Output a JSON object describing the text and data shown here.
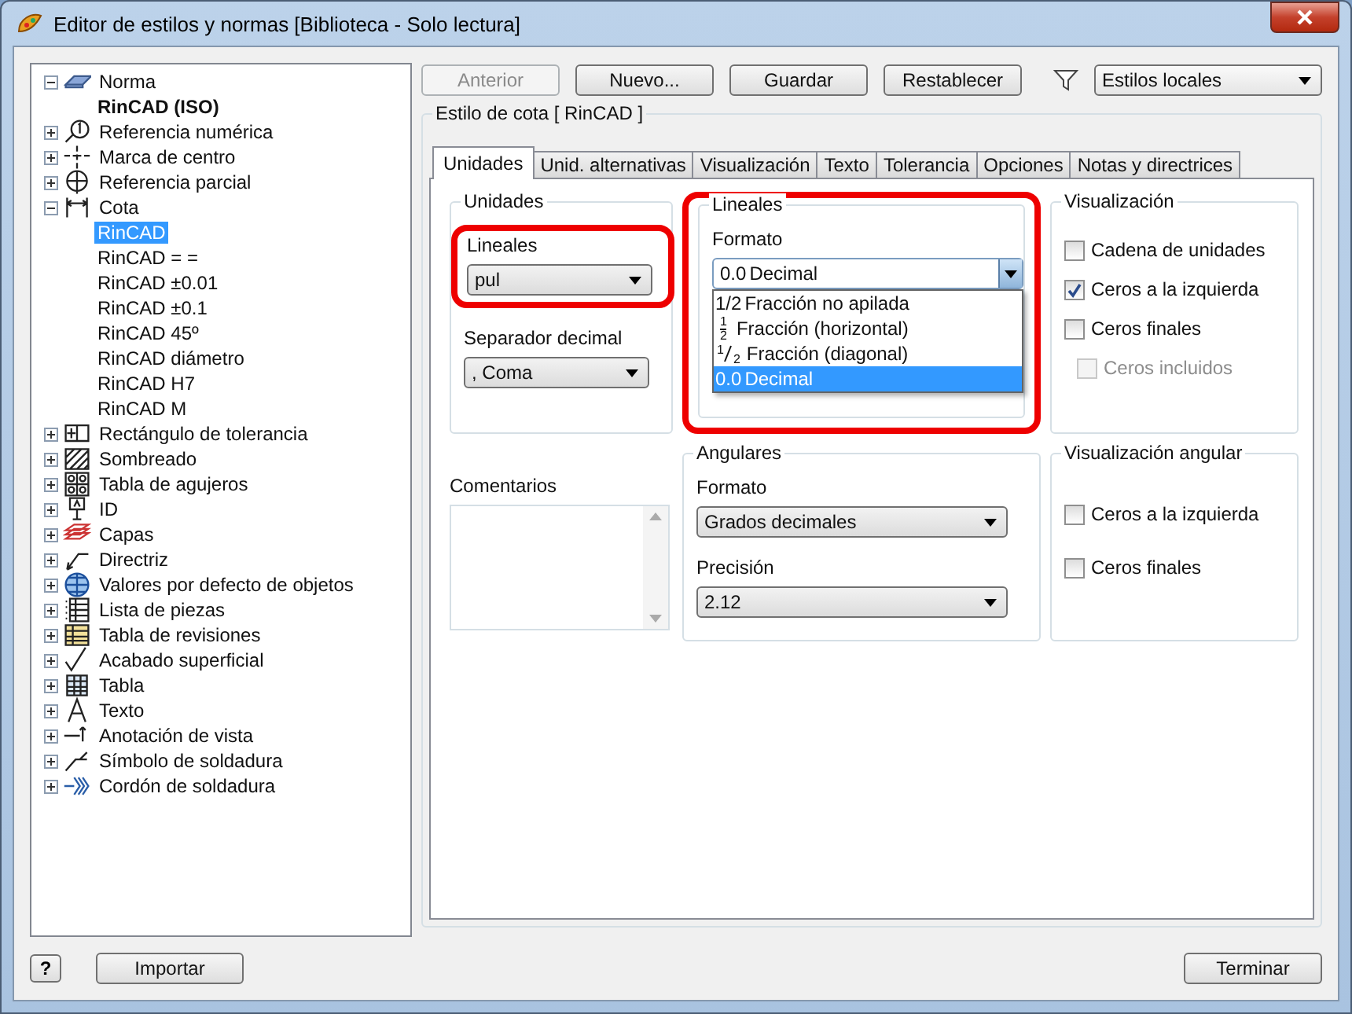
{
  "window": {
    "title": "Editor de estilos y normas [Biblioteca - Solo lectura]"
  },
  "tree": [
    {
      "label": "Norma",
      "expanded": true,
      "children": [
        {
          "label": "RinCAD (ISO)",
          "bold": true,
          "selected": false
        }
      ]
    },
    {
      "label": "Referencia numérica",
      "expanded": false
    },
    {
      "label": "Marca de centro",
      "expanded": false
    },
    {
      "label": "Referencia parcial",
      "expanded": false
    },
    {
      "label": "Cota",
      "expanded": true,
      "children": [
        {
          "label": "RinCAD",
          "bold": false,
          "selected": true
        },
        {
          "label": "RinCAD = =",
          "bold": false,
          "selected": false
        },
        {
          "label": "RinCAD ±0.01",
          "bold": false,
          "selected": false
        },
        {
          "label": "RinCAD ±0.1",
          "bold": false,
          "selected": false
        },
        {
          "label": "RinCAD 45º",
          "bold": false,
          "selected": false
        },
        {
          "label": "RinCAD diámetro",
          "bold": false,
          "selected": false
        },
        {
          "label": "RinCAD H7",
          "bold": false,
          "selected": false
        },
        {
          "label": "RinCAD M",
          "bold": false,
          "selected": false
        }
      ]
    },
    {
      "label": "Rectángulo de tolerancia",
      "expanded": false
    },
    {
      "label": "Sombreado",
      "expanded": false
    },
    {
      "label": "Tabla de agujeros",
      "expanded": false
    },
    {
      "label": "ID",
      "expanded": false
    },
    {
      "label": "Capas",
      "expanded": false
    },
    {
      "label": "Directriz",
      "expanded": false
    },
    {
      "label": "Valores por defecto de objetos",
      "expanded": false
    },
    {
      "label": "Lista de piezas",
      "expanded": false
    },
    {
      "label": "Tabla de revisiones",
      "expanded": false
    },
    {
      "label": "Acabado superficial",
      "expanded": false
    },
    {
      "label": "Tabla",
      "expanded": false
    },
    {
      "label": "Texto",
      "expanded": false
    },
    {
      "label": "Anotación de vista",
      "expanded": false
    },
    {
      "label": "Símbolo de soldadura",
      "expanded": false
    },
    {
      "label": "Cordón de soldadura",
      "expanded": false
    }
  ],
  "toolbar": {
    "buttons": [
      {
        "label": "Anterior",
        "disabled": true
      },
      {
        "label": "Nuevo...",
        "disabled": false
      },
      {
        "label": "Guardar",
        "disabled": false
      },
      {
        "label": "Restablecer",
        "disabled": false
      }
    ],
    "filter": "Estilos locales"
  },
  "style_group": {
    "title": "Estilo de cota [ RinCAD ]"
  },
  "tabs": [
    {
      "label": "Unidades",
      "selected": true
    },
    {
      "label": "Unid. alternativas",
      "selected": false
    },
    {
      "label": "Visualización",
      "selected": false
    },
    {
      "label": "Texto",
      "selected": false
    },
    {
      "label": "Tolerancia",
      "selected": false
    },
    {
      "label": "Opciones",
      "selected": false
    },
    {
      "label": "Notas y directrices",
      "selected": false
    }
  ],
  "units": {
    "title": "Unidades",
    "linear_label": "Lineales",
    "linear_value": "pul",
    "highlighted": true,
    "separator_label": "Separador decimal",
    "separator_value": ", Coma"
  },
  "linear": {
    "title": "Lineales",
    "highlighted": true,
    "format_label": "Formato",
    "format_prefix": "0.0",
    "format_value": "Decimal",
    "options": [
      {
        "kind": "inline",
        "prefix": "1/2",
        "label": "Fracción no apilada",
        "selected": false
      },
      {
        "kind": "stacked",
        "numerator": "1",
        "denominator": "2",
        "label": "Fracción (horizontal)",
        "selected": false
      },
      {
        "kind": "diagonal",
        "numerator": "1",
        "denominator": "2",
        "label": "Fracción (diagonal)",
        "selected": false
      },
      {
        "kind": "inline",
        "prefix": "0.0",
        "label": "Decimal",
        "selected": true
      }
    ]
  },
  "display": {
    "title": "Visualización",
    "checks": [
      {
        "label": "Cadena de unidades",
        "checked": false,
        "disabled": false,
        "indent": false
      },
      {
        "label": "Ceros a la izquierda",
        "checked": true,
        "disabled": false,
        "indent": false
      },
      {
        "label": "Ceros finales",
        "checked": false,
        "disabled": false,
        "indent": false
      },
      {
        "label": "Ceros incluidos",
        "checked": false,
        "disabled": true,
        "indent": true
      }
    ]
  },
  "comments": {
    "label": "Comentarios"
  },
  "angular": {
    "title": "Angulares",
    "format_label": "Formato",
    "format_value": "Grados decimales",
    "precision_label": "Precisión",
    "precision_value": "2.12"
  },
  "angular_display": {
    "title": "Visualización angular",
    "checks": [
      {
        "label": "Ceros a la izquierda",
        "checked": false
      },
      {
        "label": "Ceros finales",
        "checked": false
      }
    ]
  },
  "footer": {
    "help": "?",
    "import": "Importar",
    "finish": "Terminar"
  }
}
